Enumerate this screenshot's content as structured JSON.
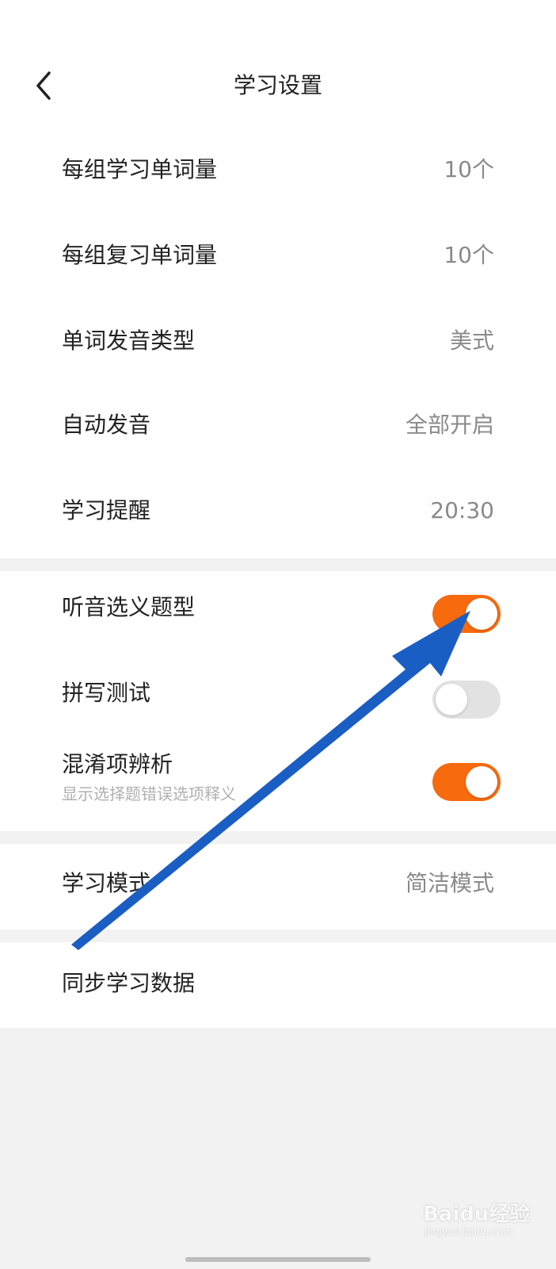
{
  "header": {
    "title": "学习设置"
  },
  "settings": {
    "daily_learn": {
      "label": "每组学习单词量",
      "value": "10个"
    },
    "daily_review": {
      "label": "每组复习单词量",
      "value": "10个"
    },
    "pronunciation_type": {
      "label": "单词发音类型",
      "value": "美式"
    },
    "auto_pronounce": {
      "label": "自动发音",
      "value": "全部开启"
    },
    "reminder": {
      "label": "学习提醒",
      "value": "20:30"
    }
  },
  "question_types": {
    "listen_choose": {
      "label": "听音选义题型",
      "enabled": true
    },
    "spelling_test": {
      "label": "拼写测试",
      "enabled": false
    },
    "confusion_analysis": {
      "label": "混淆项辨析",
      "sublabel": "显示选择题错误选项释义",
      "enabled": true
    }
  },
  "mode": {
    "label": "学习模式",
    "value": "简洁模式"
  },
  "sync": {
    "label": "同步学习数据"
  },
  "watermark": {
    "brand": "Baidu经验",
    "url": "jingyan.baidu.com"
  },
  "colors": {
    "accent": "#f76a0e",
    "toggle_off": "#e2e2e2",
    "annotation_arrow": "#1a5ec4"
  }
}
